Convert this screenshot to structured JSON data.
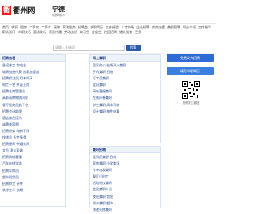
{
  "header": {
    "logo_text": "衢州网",
    "logo_mark": "衢",
    "city": "宁德",
    "city_sub": "切换城市"
  },
  "links": [
    "首页",
    "求职",
    "租房",
    "二手房",
    "二手车",
    "宠物",
    "家政服务",
    "招聘会",
    "求职简历",
    "工作经验",
    "人才市场",
    "企业招聘",
    "劳务派遣",
    "兼职招聘",
    "职业介绍",
    "工作指导",
    "职场资讯",
    "求职技巧",
    "面试技巧",
    "薪资待遇",
    "劳动法规",
    "实习生",
    "应届生",
    "校园招聘",
    "猎头服务",
    "更多"
  ],
  "search": {
    "placeholder": "请输入关键词",
    "button_label": "搜索"
  },
  "left_panel": {
    "title": "招聘信息",
    "items": [
      "急招普工 包吃住",
      "诚聘销售代表 底薪加提成",
      "招聘保洁员 月休四天",
      "电工一名 持证上岗",
      "招聘仓库管理员",
      "高薪诚聘物流司机",
      "餐厅服务员若干名",
      "招聘会计助理",
      "酒店前台接待",
      "诚聘美容师",
      "招聘保安 年龄不限",
      "快递员 多劳多得",
      "招聘厨师 待遇优厚",
      "文员 周末双休",
      "招聘网络客服",
      "汽车维修学徒",
      "招聘导购员",
      "超市理货员",
      "招聘焊工 计件",
      "装修工人 长期"
    ]
  },
  "right_top": {
    "title": "网上兼职",
    "items": [
      "居家办公 在线录入兼职",
      "手机兼职 日结",
      "打字员兼职",
      "宝妈兼职",
      "网店客服兼职",
      "在线问卷兼职",
      "学生兼职 周末可做",
      "设计兼职 按件结算"
    ]
  },
  "right_bottom": {
    "title": "兼职招聘",
    "items": [
      "促销员兼职 日结",
      "家教兼职 小学数学",
      "传单派发兼职",
      "餐厅小时工",
      "活动礼仪兼职",
      "会展兼职人员",
      "夜班兼职 包吃",
      "周末兼职 超市",
      "快递分拣兼职"
    ]
  },
  "side": {
    "post_button": "免费发布招聘",
    "resume_button": "填写求职简历",
    "qr_label": "扫码关注微信"
  }
}
